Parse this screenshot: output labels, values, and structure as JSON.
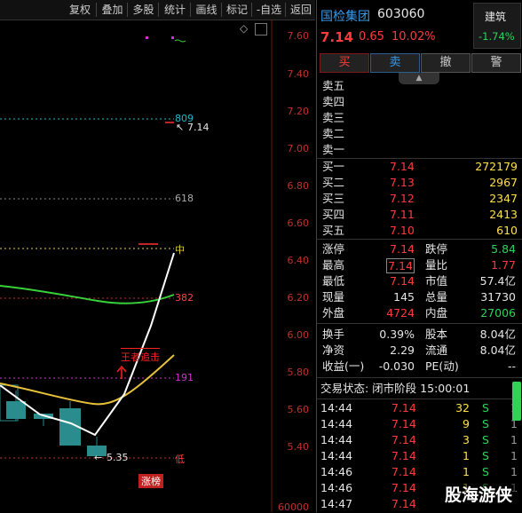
{
  "toolbar": {
    "items": [
      "复权",
      "叠加",
      "多股",
      "统计",
      "画线",
      "标记",
      "-自选",
      "返回"
    ]
  },
  "chart": {
    "price_axis": [
      "7.60",
      "7.40",
      "7.20",
      "7.00",
      "6.80",
      "6.60",
      "6.40",
      "6.20",
      "6.00",
      "5.80",
      "5.60",
      "5.40"
    ],
    "volume_axis": "60000",
    "fib_labels": {
      "l809": "809",
      "l618": "618",
      "lmid": "中",
      "l382": "382",
      "l191": "191",
      "llow": "低"
    },
    "high_marker": "7.14",
    "low_marker": "5.35",
    "signal_text": "王者追击",
    "limit_badge": "涨榜",
    "diamond": "◇"
  },
  "stock": {
    "name": "国检集团",
    "code": "603060",
    "price": "7.14",
    "change": "0.65",
    "pct": "10.02%",
    "sector": "建筑",
    "sector_pct": "-1.74%"
  },
  "buttons": {
    "buy": "买",
    "sell": "卖",
    "cancel": "撤",
    "alert": "警"
  },
  "asks": [
    {
      "label": "卖五",
      "price": "",
      "vol": ""
    },
    {
      "label": "卖四",
      "price": "",
      "vol": ""
    },
    {
      "label": "卖三",
      "price": "",
      "vol": ""
    },
    {
      "label": "卖二",
      "price": "",
      "vol": ""
    },
    {
      "label": "卖一",
      "price": "",
      "vol": ""
    }
  ],
  "bids": [
    {
      "label": "买一",
      "price": "7.14",
      "vol": "272179"
    },
    {
      "label": "买二",
      "price": "7.13",
      "vol": "2967"
    },
    {
      "label": "买三",
      "price": "7.12",
      "vol": "2347"
    },
    {
      "label": "买四",
      "price": "7.11",
      "vol": "2413"
    },
    {
      "label": "买五",
      "price": "7.10",
      "vol": "610"
    }
  ],
  "stats": [
    {
      "l1": "涨停",
      "v1": "7.14",
      "l2": "跌停",
      "v2": "5.84"
    },
    {
      "l1": "最高",
      "v1": "7.14",
      "l2": "量比",
      "v2": "1.77"
    },
    {
      "l1": "最低",
      "v1": "7.14",
      "l2": "市值",
      "v2": "57.4亿"
    },
    {
      "l1": "现量",
      "v1": "145",
      "l2": "总量",
      "v2": "31730"
    },
    {
      "l1": "外盘",
      "v1": "4724",
      "l2": "内盘",
      "v2": "27006"
    },
    {
      "l1": "换手",
      "v1": "0.39%",
      "l2": "股本",
      "v2": "8.04亿"
    },
    {
      "l1": "净资",
      "v1": "2.29",
      "l2": "流通",
      "v2": "8.04亿"
    },
    {
      "l1": "收益(一)",
      "v1": "-0.030",
      "l2": "PE(动)",
      "v2": "--"
    }
  ],
  "trade_status": "交易状态: 闭市阶段 15:00:01",
  "ticks": [
    {
      "time": "14:44",
      "price": "7.14",
      "vol": "32",
      "dir": "S",
      "n": "1"
    },
    {
      "time": "14:44",
      "price": "7.14",
      "vol": "9",
      "dir": "S",
      "n": "1"
    },
    {
      "time": "14:44",
      "price": "7.14",
      "vol": "3",
      "dir": "S",
      "n": "1"
    },
    {
      "time": "14:44",
      "price": "7.14",
      "vol": "1",
      "dir": "S",
      "n": "1"
    },
    {
      "time": "14:46",
      "price": "7.14",
      "vol": "1",
      "dir": "S",
      "n": "1"
    },
    {
      "time": "14:46",
      "price": "7.14",
      "vol": "1",
      "dir": "S",
      "n": "1"
    },
    {
      "time": "14:47",
      "price": "7.14",
      "vol": "",
      "dir": "",
      "n": ""
    }
  ],
  "watermark": "股海游侠",
  "colors": {
    "up": "#ff3b3b",
    "down": "#2fd35a",
    "ma_yellow": "#e8c23a",
    "ma_green": "#37d23a",
    "bg": "#000000"
  }
}
